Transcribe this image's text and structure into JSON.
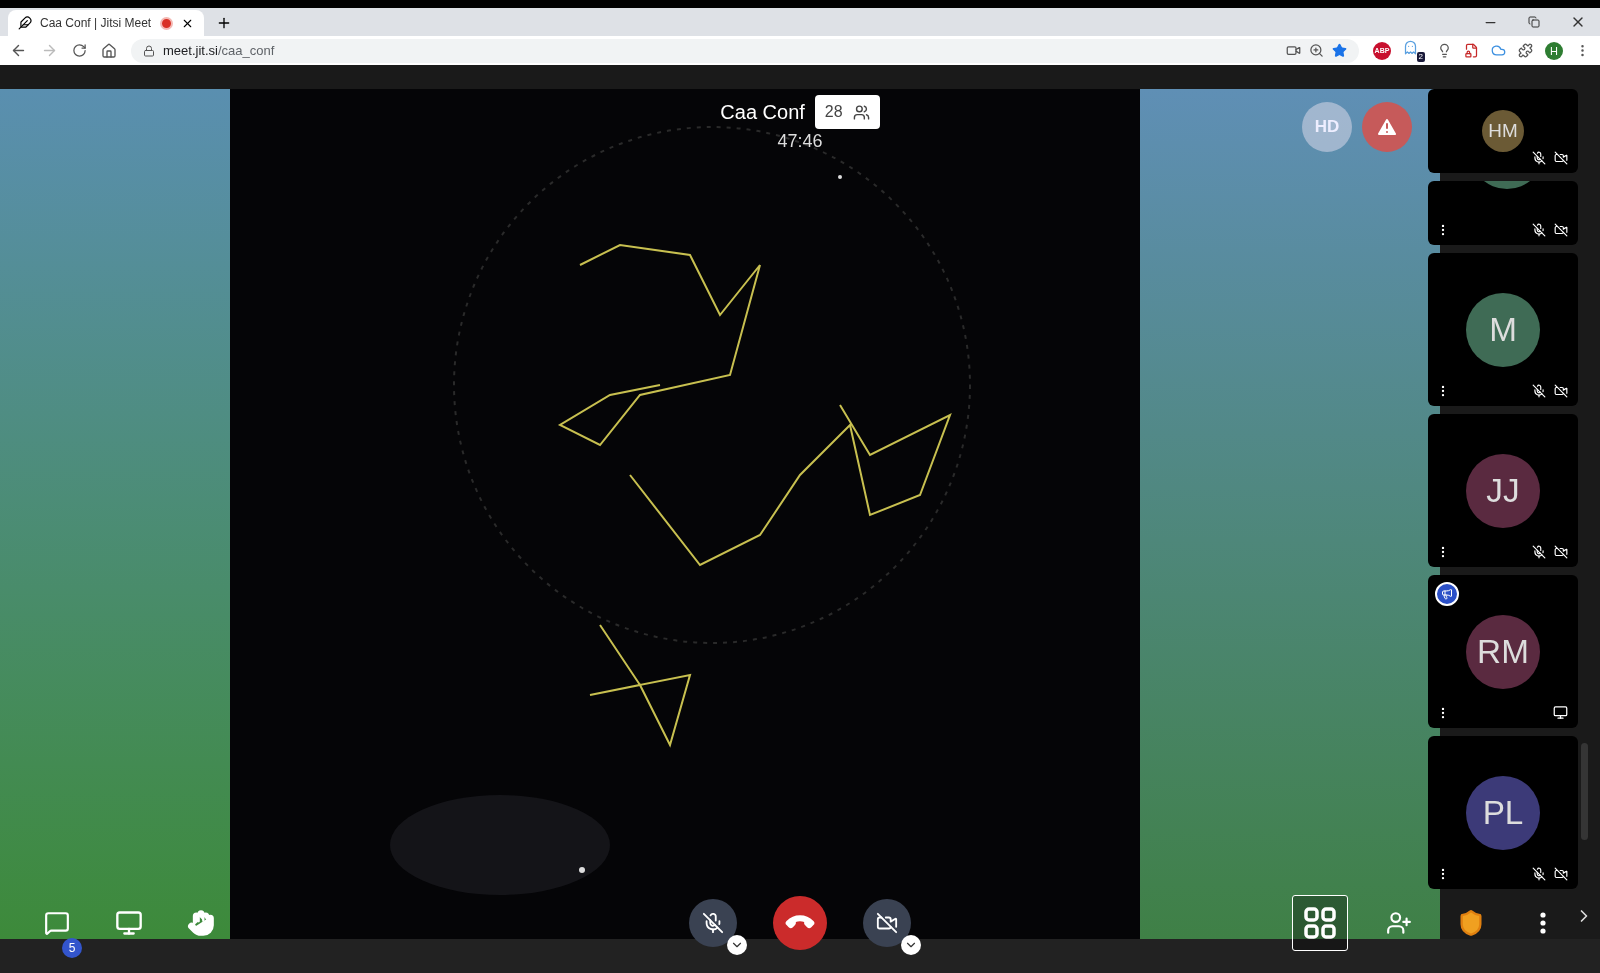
{
  "browser": {
    "tab": {
      "title": "Caa Conf | Jitsi Meet",
      "recording": true,
      "selected": true
    },
    "url": {
      "host": "meet.jit.si",
      "path": "/caa_conf"
    },
    "nav": {
      "forward_disabled": true
    },
    "extensions": {
      "abp_label": "ABP",
      "ghost_badge": "2",
      "profile_initial": "H"
    }
  },
  "meeting": {
    "title": "Caa Conf",
    "participant_count": "28",
    "timer": "47:46",
    "quality": "HD",
    "warning": true
  },
  "filmstrip": {
    "tiles": [
      {
        "kind": "compact",
        "initials": "HM",
        "color": "#6b5a35",
        "audio_muted": true,
        "video_muted": true,
        "menu": false,
        "screen_sharing": false,
        "speaker_badge": false
      },
      {
        "kind": "partial",
        "color": "#3f6b55",
        "audio_muted": true,
        "video_muted": true,
        "menu": true,
        "screen_sharing": false,
        "speaker_badge": false
      },
      {
        "kind": "full",
        "initials": "M",
        "color": "#3f6b55",
        "audio_muted": true,
        "video_muted": true,
        "menu": true,
        "screen_sharing": false,
        "speaker_badge": false
      },
      {
        "kind": "full",
        "initials": "JJ",
        "color": "#5a2a40",
        "audio_muted": true,
        "video_muted": true,
        "menu": true,
        "screen_sharing": false,
        "speaker_badge": false
      },
      {
        "kind": "full",
        "initials": "RM",
        "color": "#5a2a40",
        "audio_muted": false,
        "video_muted": false,
        "menu": true,
        "screen_sharing": true,
        "speaker_badge": true
      },
      {
        "kind": "full",
        "initials": "PL",
        "color": "#3c3a78",
        "audio_muted": true,
        "video_muted": true,
        "menu": true,
        "screen_sharing": false,
        "speaker_badge": false
      }
    ]
  },
  "toolbar": {
    "chat_badge": "5",
    "mic_muted": true,
    "camera_muted": true,
    "tile_view_selected": true
  }
}
